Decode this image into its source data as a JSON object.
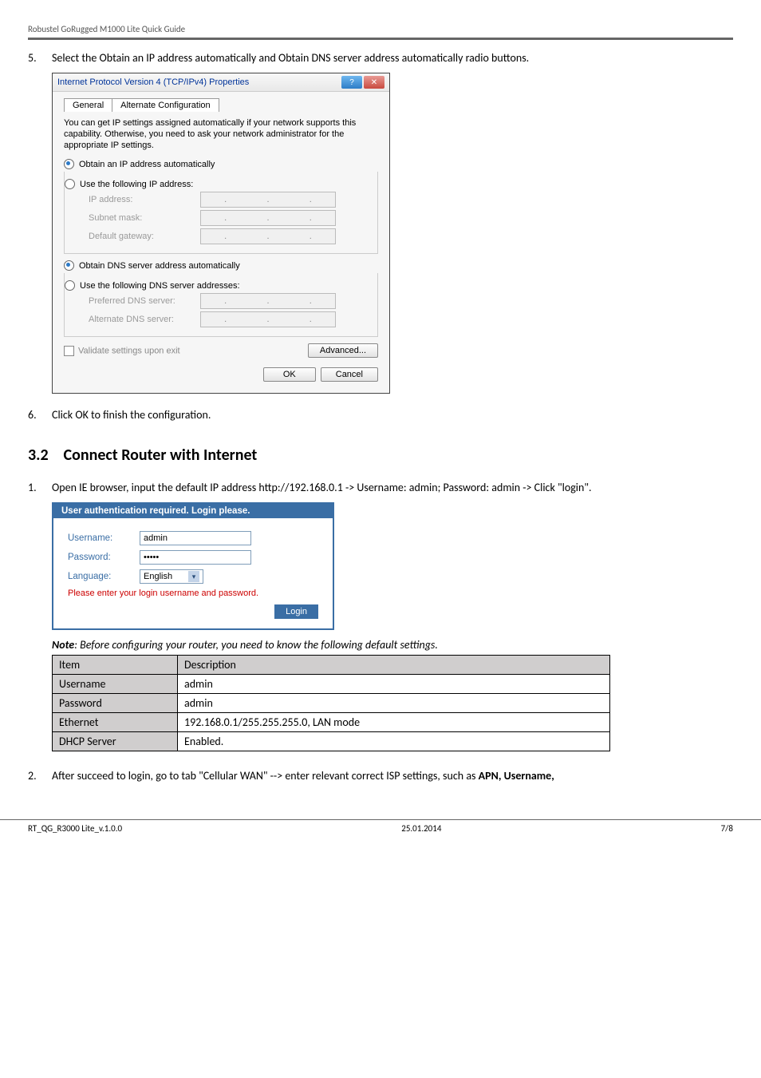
{
  "doc_header": "Robustel GoRugged M1000 Lite Quick Guide",
  "step5": {
    "num": "5.",
    "text": "Select the Obtain an IP address automatically and Obtain DNS server address automatically radio buttons."
  },
  "dialog": {
    "title": "Internet Protocol Version 4 (TCP/IPv4) Properties",
    "tab_general": "General",
    "tab_alt": "Alternate Configuration",
    "intro": "You can get IP settings assigned automatically if your network supports this capability. Otherwise, you need to ask your network administrator for the appropriate IP settings.",
    "auto_ip": "Obtain an IP address automatically",
    "use_ip": "Use the following IP address:",
    "ip_addr": "IP address:",
    "subnet": "Subnet mask:",
    "gateway": "Default gateway:",
    "auto_dns": "Obtain DNS server address automatically",
    "use_dns": "Use the following DNS server addresses:",
    "pref_dns": "Preferred DNS server:",
    "alt_dns": "Alternate DNS server:",
    "validate": "Validate settings upon exit",
    "advanced": "Advanced...",
    "ok": "OK",
    "cancel": "Cancel"
  },
  "step6": {
    "num": "6.",
    "text": "Click OK to finish the configuration."
  },
  "section32": {
    "num": "3.2",
    "title": "Connect Router with Internet"
  },
  "step1": {
    "num": "1.",
    "text": "Open IE browser, input the default IP address http://192.168.0.1 -> Username: admin; Password: admin -> Click \"login\"."
  },
  "login": {
    "title": "User authentication required. Login please.",
    "username_lbl": "Username:",
    "username_val": "admin",
    "password_lbl": "Password:",
    "password_val": "•••••",
    "language_lbl": "Language:",
    "language_val": "English",
    "msg": "Please enter your login username and password.",
    "btn": "Login"
  },
  "note_line": "Note: Before configuring your router, you need to know the following default settings.",
  "table": {
    "h_item": "Item",
    "h_desc": "Description",
    "rows": [
      {
        "k": "Username",
        "v": "admin"
      },
      {
        "k": "Password",
        "v": "admin"
      },
      {
        "k": "Ethernet",
        "v": "192.168.0.1/255.255.255.0, LAN mode"
      },
      {
        "k": "DHCP Server",
        "v": "Enabled."
      }
    ]
  },
  "step2": {
    "num": "2.",
    "text_a": "After succeed to login, go to tab \"Cellular WAN\" --> enter relevant correct ISP settings, such as ",
    "text_b": "APN, Username,"
  },
  "footer": {
    "left": "RT_QG_R3000 Lite_v.1.0.0",
    "mid": "25.01.2014",
    "right": "7/8"
  }
}
